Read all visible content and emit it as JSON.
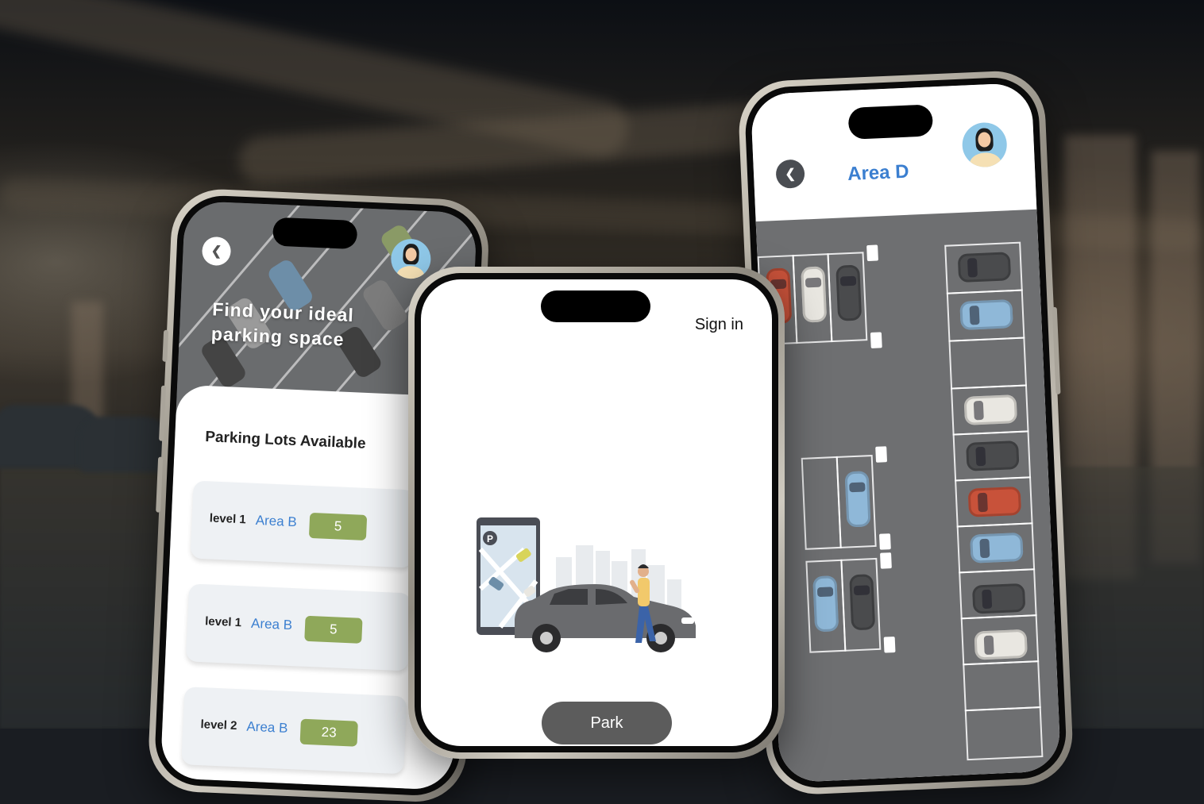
{
  "left_screen": {
    "title": "Find your ideal parking space",
    "section_title": "Parking Lots Available",
    "lots": [
      {
        "level": "level 1",
        "area": "Area B",
        "count": "5"
      },
      {
        "level": "level 1",
        "area": "Area B",
        "count": "5"
      },
      {
        "level": "level 2",
        "area": "Area B",
        "count": "23"
      }
    ]
  },
  "center_screen": {
    "signin_label": "Sign in",
    "park_label": "Park",
    "map_pin_label": "P"
  },
  "right_screen": {
    "title": "Area D"
  },
  "icons": {
    "back": "back-chevron-icon",
    "avatar": "user-avatar-icon"
  },
  "colors": {
    "accent_blue": "#3b7fd0",
    "count_green": "#8fa85a",
    "lot_gray": "#6e6f71",
    "button_gray": "#5c5c5c"
  }
}
